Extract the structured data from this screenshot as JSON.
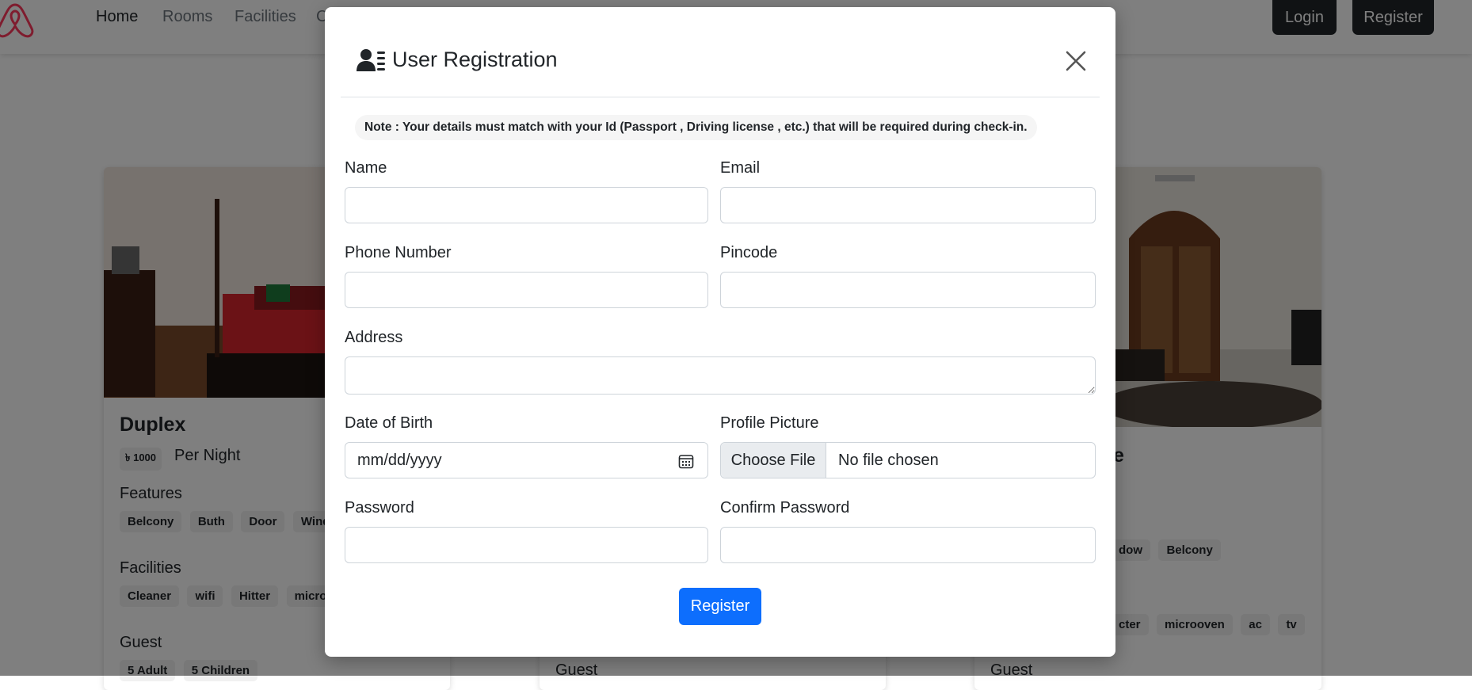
{
  "navbar": {
    "links": [
      "Home",
      "Rooms",
      "Facilities",
      "C"
    ],
    "login_label": "Login",
    "register_label": "Register"
  },
  "room_cards": [
    {
      "name": "Duplex",
      "price": "৳ 1000",
      "price_suffix": "Per Night",
      "features_label": "Features",
      "features": [
        "Belcony",
        "Buth",
        "Door",
        "Windo"
      ],
      "facilities_label": "Facilities",
      "facilities": [
        "Cleaner",
        "wifi",
        "Hitter",
        "microov"
      ],
      "guest_label": "Guest",
      "guests": [
        "5 Adult",
        "5 Children"
      ]
    },
    {
      "guest_label": "Guest"
    },
    {
      "name_fragment": "e",
      "features": [
        "dow",
        "Belcony"
      ],
      "facilities": [
        "cter",
        "microoven",
        "ac",
        "tv"
      ],
      "guest_label": "Guest"
    }
  ],
  "modal": {
    "title": "User Registration",
    "note": "Note : Your details must match with your Id (Passport , Driving license , etc.) that will be required during check-in.",
    "fields": {
      "name_label": "Name",
      "email_label": "Email",
      "phone_label": "Phone Number",
      "pincode_label": "Pincode",
      "address_label": "Address",
      "dob_label": "Date of Birth",
      "dob_placeholder": "mm/dd/yyyy",
      "picture_label": "Profile Picture",
      "file_button": "Choose File",
      "file_status": "No file chosen",
      "password_label": "Password",
      "confirm_password_label": "Confirm Password"
    },
    "submit_label": "Register"
  },
  "colors": {
    "primary": "#0d6efd",
    "dark": "#212529",
    "backdrop": "rgba(0,0,0,0.5)"
  }
}
